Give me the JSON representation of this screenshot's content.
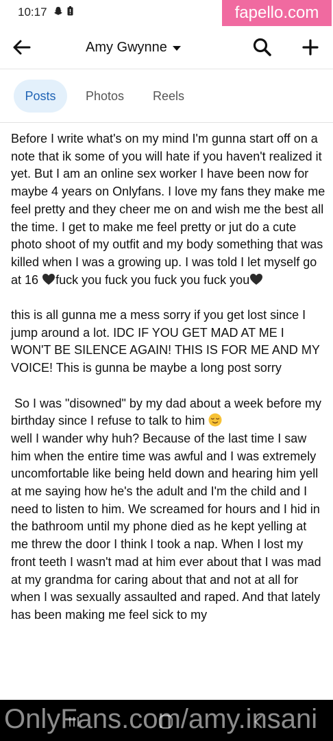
{
  "status_bar": {
    "time": "10:17",
    "icons": [
      "snapchat-icon",
      "battery-icon"
    ]
  },
  "watermark_top": "fapello.com",
  "header": {
    "title": "Amy Gwynne"
  },
  "tabs": [
    {
      "label": "Posts",
      "active": true
    },
    {
      "label": "Photos",
      "active": false
    },
    {
      "label": "Reels",
      "active": false
    }
  ],
  "post": {
    "p1": "Before I write what's on my mind I'm gunna start off on a note that ik some of you will hate if you haven't realized it yet. But I am an online sex worker I have been now for maybe 4 years on Onlyfans. I love my fans they make me feel pretty and they cheer me on and wish me the best all the time. I get to make me feel pretty or jut do a cute photo shoot of my outfit and my body something that was killed when I was a growing up. I was told I let myself go at 16",
    "p1_tail": "fuck you fuck you fuck you fuck you",
    "p2": "this is all gunna me a mess sorry if you get lost since I jump around a lot. IDC IF YOU GET MAD AT ME I WON'T BE SILENCE AGAIN! THIS IS FOR ME AND MY VOICE! This is gunna be maybe a long post sorry",
    "p3_head": " So I was \"disowned\" by my dad about a week before my birthday since I refuse to talk to him",
    "p3": "well I wander why huh? Because of the last time I saw him when the entire time was awful and I was extremely uncomfortable like being held down and hearing him yell at me saying how he's the adult and I'm the child and I need to listen to him. We screamed for hours and I hid in the bathroom until my phone died as he kept yelling at me threw the door I think I took a nap. When I lost my front teeth I wasn't mad at him ever about that I was mad at my grandma for caring about that and not at all for when I was sexually assaulted and raped. And that lately has been making me feel sick to my",
    "emoji": [
      "black-heart-icon",
      "relieved-face-icon"
    ]
  },
  "watermark_bottom": "OnlyFans.com/amy.insani",
  "colors": {
    "accent": "#1f63b5",
    "tab_active_bg": "#e3f0fb",
    "watermark_bg": "#f06aa0"
  }
}
